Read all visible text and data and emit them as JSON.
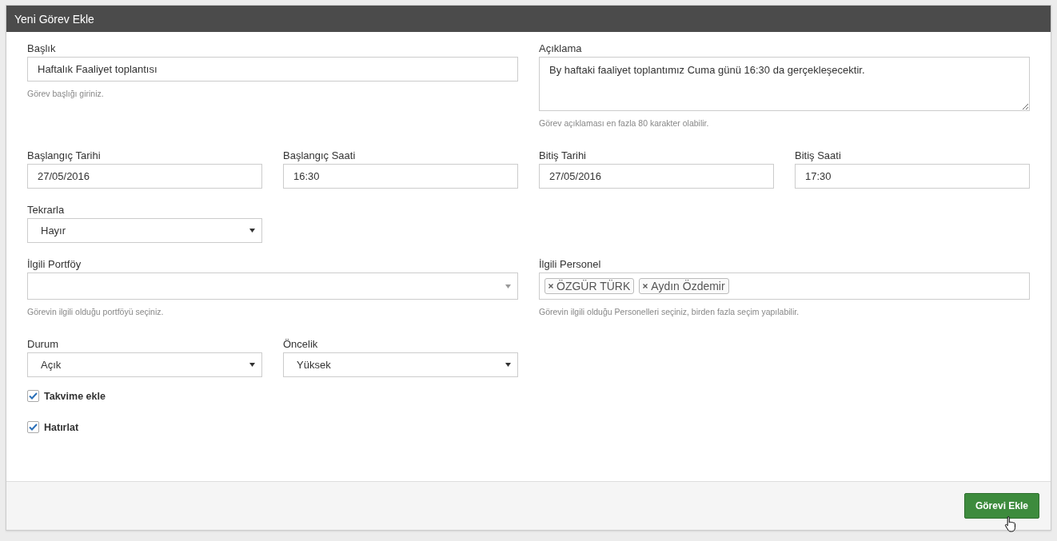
{
  "panel": {
    "title": "Yeni Görev Ekle"
  },
  "rows": [
    {
      "left": [
        {
          "kind": "text",
          "label": "Başlık",
          "value": "Haftalık Faaliyet toplantısı",
          "help": "Görev başlığı giriniz."
        }
      ],
      "right": [
        {
          "kind": "textarea",
          "label": "Açıklama",
          "value": "By haftaki faaliyet toplantımız Cuma günü 16:30 da gerçekleşecektir.",
          "help": "Görev açıklaması en fazla 80 karakter olabilir."
        }
      ]
    },
    {
      "left": [
        {
          "kind": "text",
          "label": "Başlangıç Tarihi",
          "value": "27/05/2016"
        },
        {
          "kind": "text",
          "label": "Başlangıç Saati",
          "value": "16:30"
        }
      ],
      "right": [
        {
          "kind": "text",
          "label": "Bitiş Tarihi",
          "value": "27/05/2016"
        },
        {
          "kind": "text",
          "label": "Bitiş Saati",
          "value": "17:30"
        }
      ]
    },
    {
      "left": [
        {
          "kind": "select",
          "label": "Tekrarla",
          "value": "Hayır"
        }
      ],
      "right": []
    },
    {
      "left": [
        {
          "kind": "combo",
          "label": "İlgili Portföy",
          "help": "Görevin ilgili olduğu portföyü seçiniz."
        }
      ],
      "right": [
        {
          "kind": "tags",
          "label": "İlgili Personel",
          "tags": [
            "ÖZGÜR TÜRK",
            "Aydın Özdemir"
          ],
          "help": "Görevin ilgili olduğu Personelleri seçiniz, birden fazla seçim yapılabilir."
        }
      ]
    },
    {
      "left": [
        {
          "kind": "select",
          "label": "Durum",
          "value": "Açık"
        },
        {
          "kind": "select",
          "label": "Öncelik",
          "value": "Yüksek"
        }
      ],
      "right": []
    }
  ],
  "checkboxes": [
    {
      "label": "Takvime ekle",
      "checked": true
    },
    {
      "label": "Hatırlat",
      "checked": true
    }
  ],
  "submit": {
    "label": "Görevi Ekle"
  }
}
